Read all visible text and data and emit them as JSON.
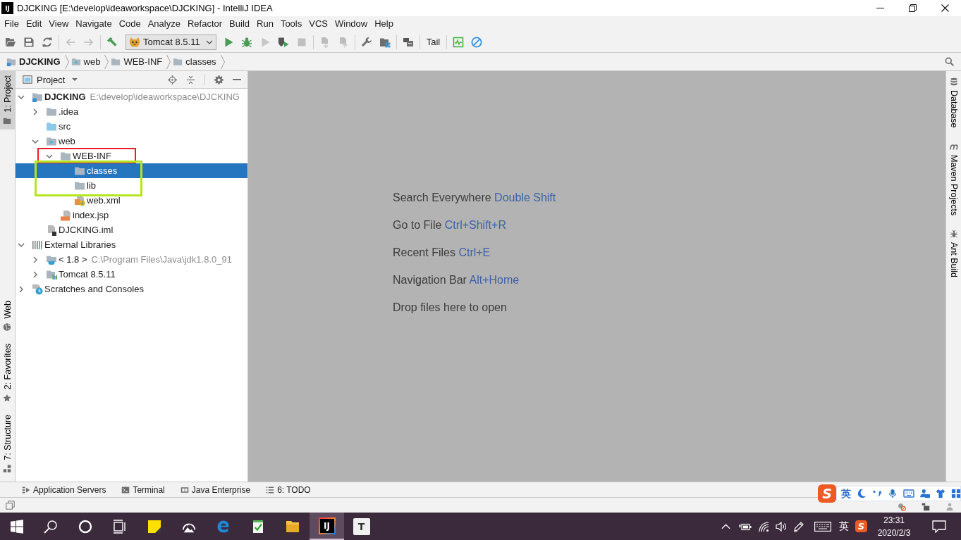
{
  "window": {
    "logo": "IJ",
    "title": "DJCKING [E:\\develop\\ideaworkspace\\DJCKING] - IntelliJ IDEA"
  },
  "menu": [
    "File",
    "Edit",
    "View",
    "Navigate",
    "Code",
    "Analyze",
    "Refactor",
    "Build",
    "Run",
    "Tools",
    "VCS",
    "Window",
    "Help"
  ],
  "toolbar": [
    {
      "kind": "button",
      "disabled": false
    },
    {
      "kind": "button",
      "disabled": false
    },
    {
      "kind": "button",
      "disabled": false
    },
    {
      "kind": "separator"
    },
    {
      "kind": "button",
      "disabled": true
    },
    {
      "kind": "button",
      "disabled": true
    },
    {
      "kind": "separator"
    },
    {
      "kind": "button",
      "disabled": false
    },
    {
      "kind": "run_config",
      "label": "Tomcat 8.5.11"
    },
    {
      "kind": "button",
      "disabled": false
    },
    {
      "kind": "button",
      "disabled": false
    },
    {
      "kind": "button",
      "disabled": true
    },
    {
      "kind": "button",
      "disabled": false
    },
    {
      "kind": "button",
      "disabled": true
    },
    {
      "kind": "separator"
    },
    {
      "kind": "button",
      "disabled": true
    },
    {
      "kind": "button",
      "disabled": true
    },
    {
      "kind": "separator"
    },
    {
      "kind": "button",
      "disabled": false
    },
    {
      "kind": "button",
      "disabled": false
    },
    {
      "kind": "separator"
    },
    {
      "kind": "button",
      "disabled": false
    },
    {
      "kind": "separator"
    },
    {
      "kind": "text_button",
      "label": "Tail"
    },
    {
      "kind": "separator"
    },
    {
      "kind": "button",
      "disabled": false
    },
    {
      "kind": "button",
      "disabled": false
    }
  ],
  "nav_bar": {
    "crumbs": [
      {
        "label": "DJCKING",
        "kind": "module"
      },
      {
        "label": "web",
        "kind": "web_folder"
      },
      {
        "label": "WEB-INF",
        "kind": "folder"
      },
      {
        "label": "classes",
        "kind": "folder"
      }
    ]
  },
  "left_stripe": {
    "top": [
      {
        "label": "1: Project",
        "selected": true
      }
    ],
    "bottom": [
      {
        "label": "Web",
        "selected": false
      },
      {
        "label": "2: Favorites",
        "selected": false
      },
      {
        "label": "7: Structure",
        "selected": false
      }
    ]
  },
  "project_panel": {
    "view": "Project",
    "tree": [
      {
        "label": "DJCKING",
        "kind": "module",
        "detail": "E:\\develop\\ideaworkspace\\DJCKING",
        "expanded": true,
        "selected": false,
        "children": [
          {
            "label": ".idea",
            "kind": "folder",
            "expanded": false,
            "selected": false
          },
          {
            "label": "src",
            "kind": "source_folder",
            "selected": false
          },
          {
            "label": "web",
            "kind": "web_folder",
            "expanded": true,
            "selected": false,
            "children": [
              {
                "label": "WEB-INF",
                "kind": "folder",
                "expanded": true,
                "selected": false,
                "children": [
                  {
                    "label": "classes",
                    "kind": "folder",
                    "selected": true
                  },
                  {
                    "label": "lib",
                    "kind": "folder",
                    "selected": false
                  },
                  {
                    "label": "web.xml",
                    "kind": "xml_file",
                    "selected": false
                  }
                ]
              },
              {
                "label": "index.jsp",
                "kind": "jsp_file",
                "selected": false
              }
            ]
          },
          {
            "label": "DJCKING.iml",
            "kind": "iml_file",
            "selected": false
          }
        ]
      },
      {
        "label": "External Libraries",
        "kind": "libraries",
        "expanded": true,
        "selected": false,
        "children": [
          {
            "label": "< 1.8 >",
            "kind": "jdk",
            "detail": "C:\\Program Files\\Java\\jdk1.8.0_91",
            "expanded": false,
            "selected": false
          },
          {
            "label": "Tomcat 8.5.11",
            "kind": "library",
            "expanded": false,
            "selected": false
          }
        ]
      },
      {
        "label": "Scratches and Consoles",
        "kind": "scratches",
        "expanded": false,
        "selected": false
      }
    ]
  },
  "annotation_frames": [
    {
      "color": "#ed1c24"
    },
    {
      "color": "#b5e61d"
    }
  ],
  "editor": {
    "hints": [
      {
        "action": "Search Everywhere",
        "shortcut": "Double Shift"
      },
      {
        "action": "Go to File",
        "shortcut": "Ctrl+Shift+R"
      },
      {
        "action": "Recent Files",
        "shortcut": "Ctrl+E"
      },
      {
        "action": "Navigation Bar",
        "shortcut": "Alt+Home"
      },
      {
        "action": "Drop files here to open"
      }
    ]
  },
  "right_stripe": [
    {
      "label": "Database",
      "selected": false
    },
    {
      "label": "Maven Projects",
      "selected": false
    },
    {
      "label": "Ant Build",
      "selected": false
    }
  ],
  "bottom_bar": [
    {
      "label": "Application Servers",
      "selected": false
    },
    {
      "label": "Terminal",
      "selected": false
    },
    {
      "label": "Java Enterprise",
      "selected": false
    },
    {
      "label": "6: TODO",
      "selected": false
    }
  ],
  "ime_toolbar": {
    "logo": "S",
    "mode": "英"
  },
  "taskbar": {
    "apps": [
      {
        "active": false
      },
      {
        "active": false
      },
      {
        "active": false
      },
      {
        "active": false
      },
      {
        "active": false
      },
      {
        "active": false
      },
      {
        "active": false
      },
      {
        "active": false
      },
      {
        "active": false
      },
      {
        "active": true,
        "logo": "IJ"
      },
      {
        "active": false,
        "logo": "T"
      }
    ],
    "tray": {
      "input_mode": "英",
      "ime_logo": "S",
      "time": "23:31",
      "date": "2020/2/3"
    }
  }
}
